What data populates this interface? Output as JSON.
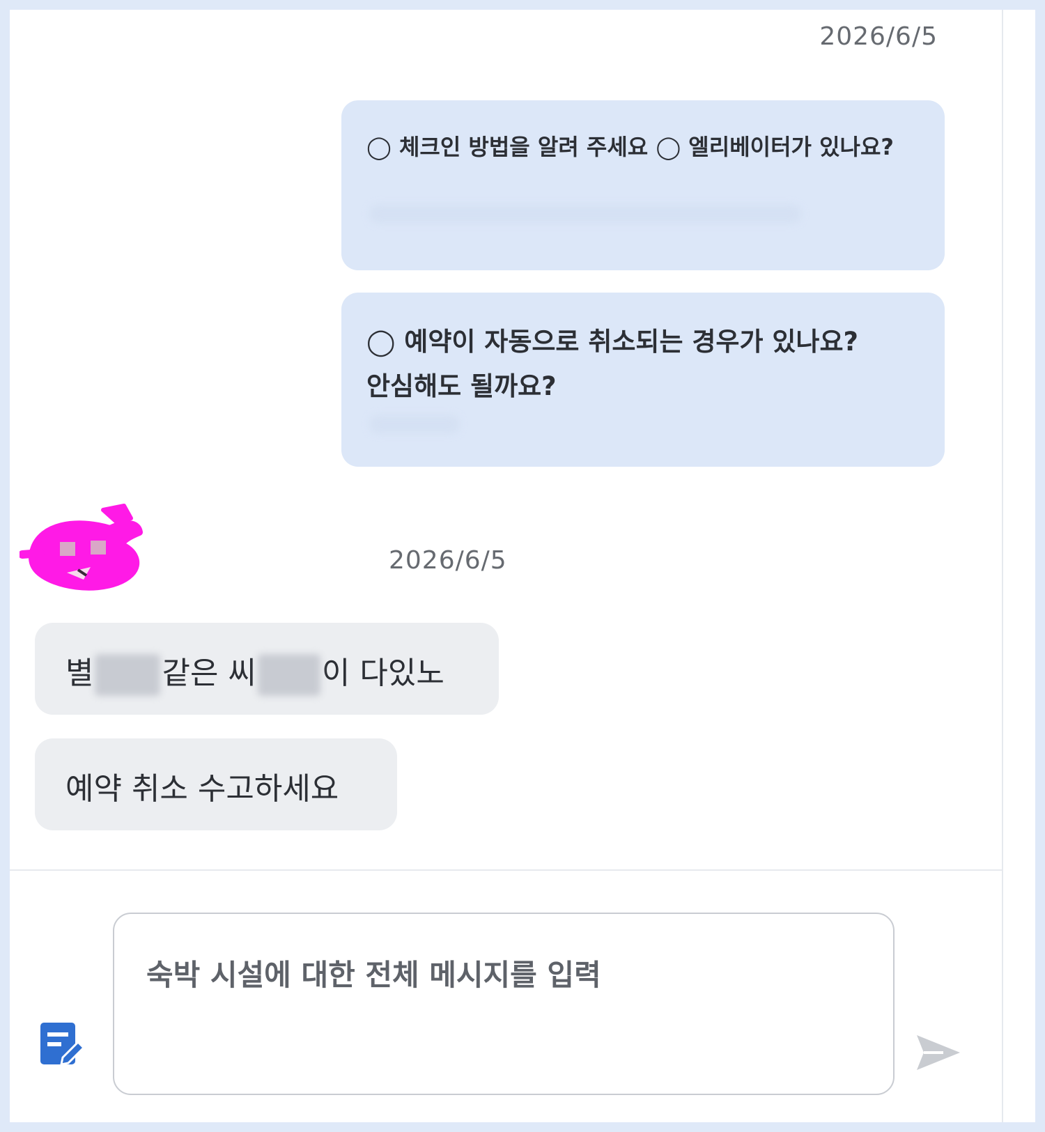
{
  "chat": {
    "outgoing": {
      "timestamp": "2026/6/5",
      "messages": [
        {
          "line1": "◯ 체크인 방법을 알려 주세요 ◯ 엘리베이터가 있나요?"
        },
        {
          "line1": "◯ 예약이 자동으로 취소되는 경우가 있나요?",
          "line2": "안심해도 될까요?"
        }
      ]
    },
    "incoming": {
      "timestamp": "2026/6/5",
      "messages": [
        {
          "part1": "별",
          "part2": "같은 씨",
          "part3": "이 다있노"
        },
        {
          "text": "예약 취소 수고하세요"
        }
      ]
    }
  },
  "composer": {
    "placeholder": "숙박 시설에 대한 전체 메시지를 입력",
    "value": ""
  },
  "icons": {
    "compose": "compose-edit-icon",
    "send": "send-arrow-icon",
    "avatar": "host-avatar"
  },
  "colors": {
    "outgoing_bubble": "#dce7f8",
    "incoming_bubble": "#eceef1",
    "compose_icon": "#2f6fd1",
    "avatar_accent": "#ff1ae6"
  }
}
